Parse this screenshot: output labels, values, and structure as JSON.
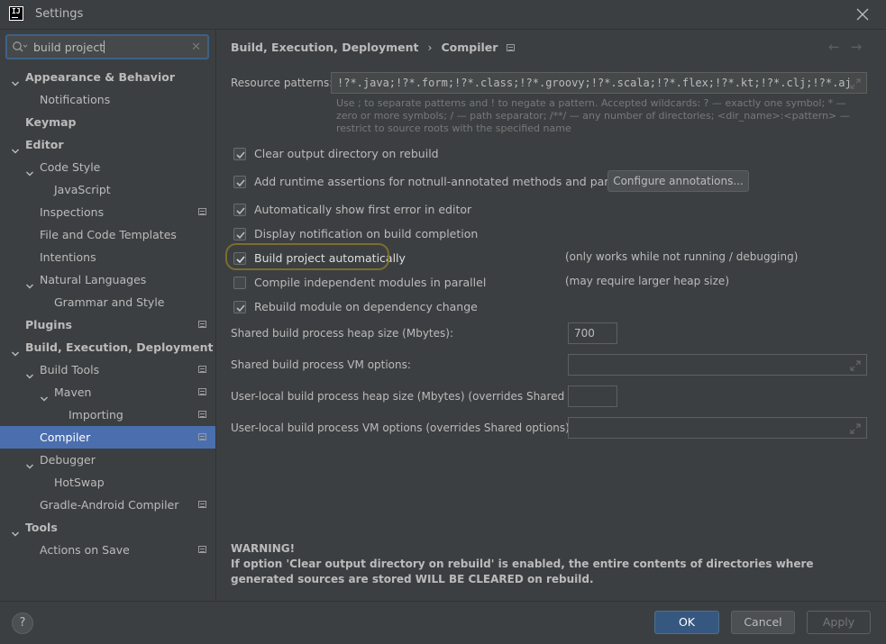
{
  "window": {
    "title": "Settings",
    "app_icon_text": "IJ"
  },
  "search": {
    "value": "build project"
  },
  "sidebar": {
    "items": [
      {
        "label": "Appearance & Behavior",
        "level": 0,
        "arrow": "down",
        "bold": true,
        "tag": false
      },
      {
        "label": "Notifications",
        "level": 1,
        "arrow": "",
        "bold": false,
        "tag": false
      },
      {
        "label": "Keymap",
        "level": 0,
        "arrow": "",
        "bold": true,
        "tag": false
      },
      {
        "label": "Editor",
        "level": 0,
        "arrow": "down",
        "bold": true,
        "tag": false
      },
      {
        "label": "Code Style",
        "level": 1,
        "arrow": "down",
        "bold": false,
        "tag": false
      },
      {
        "label": "JavaScript",
        "level": 2,
        "arrow": "",
        "bold": false,
        "tag": false
      },
      {
        "label": "Inspections",
        "level": 1,
        "arrow": "",
        "bold": false,
        "tag": true
      },
      {
        "label": "File and Code Templates",
        "level": 1,
        "arrow": "",
        "bold": false,
        "tag": false
      },
      {
        "label": "Intentions",
        "level": 1,
        "arrow": "",
        "bold": false,
        "tag": false
      },
      {
        "label": "Natural Languages",
        "level": 1,
        "arrow": "down",
        "bold": false,
        "tag": false
      },
      {
        "label": "Grammar and Style",
        "level": 2,
        "arrow": "",
        "bold": false,
        "tag": false
      },
      {
        "label": "Plugins",
        "level": 0,
        "arrow": "",
        "bold": true,
        "tag": true
      },
      {
        "label": "Build, Execution, Deployment",
        "level": 0,
        "arrow": "down",
        "bold": true,
        "tag": false
      },
      {
        "label": "Build Tools",
        "level": 1,
        "arrow": "down",
        "bold": false,
        "tag": true
      },
      {
        "label": "Maven",
        "level": 2,
        "arrow": "down",
        "bold": false,
        "tag": true
      },
      {
        "label": "Importing",
        "level": 3,
        "arrow": "",
        "bold": false,
        "tag": true
      },
      {
        "label": "Compiler",
        "level": 1,
        "arrow": "",
        "bold": false,
        "tag": true,
        "selected": true
      },
      {
        "label": "Debugger",
        "level": 1,
        "arrow": "down",
        "bold": false,
        "tag": false
      },
      {
        "label": "HotSwap",
        "level": 2,
        "arrow": "",
        "bold": false,
        "tag": false
      },
      {
        "label": "Gradle-Android Compiler",
        "level": 1,
        "arrow": "",
        "bold": false,
        "tag": true
      },
      {
        "label": "Tools",
        "level": 0,
        "arrow": "down",
        "bold": true,
        "tag": false
      },
      {
        "label": "Actions on Save",
        "level": 1,
        "arrow": "",
        "bold": false,
        "tag": true
      }
    ]
  },
  "breadcrumb": {
    "parent": "Build, Execution, Deployment",
    "separator": "›",
    "current": "Compiler"
  },
  "resource_patterns": {
    "label": "Resource patterns:",
    "value": "!?*.java;!?*.form;!?*.class;!?*.groovy;!?*.scala;!?*.flex;!?*.kt;!?*.clj;!?*.aj",
    "hint": "Use ; to separate patterns and ! to negate a pattern. Accepted wildcards: ? — exactly one symbol; * — zero or more symbols; / — path separator; /**/ — any number of directories; <dir_name>:<pattern> — restrict to source roots with the specified name"
  },
  "options": {
    "clear_output": {
      "label": "Clear output directory on rebuild",
      "checked": true
    },
    "runtime_assertions": {
      "label": "Add runtime assertions for notnull-annotated methods and parameters",
      "checked": true
    },
    "configure_annotations": "Configure annotations...",
    "show_first_error": {
      "label": "Automatically show first error in editor",
      "checked": true
    },
    "display_notification": {
      "label": "Display notification on build completion",
      "checked": true
    },
    "build_automatically": {
      "label": "Build project automatically",
      "checked": true,
      "note": "(only works while not running / debugging)"
    },
    "compile_parallel": {
      "label": "Compile independent modules in parallel",
      "checked": false,
      "note": "(may require larger heap size)"
    },
    "rebuild_module": {
      "label": "Rebuild module on dependency change",
      "checked": true
    }
  },
  "fields": {
    "shared_heap": {
      "label": "Shared build process heap size (Mbytes):",
      "value": "700"
    },
    "shared_vm": {
      "label": "Shared build process VM options:",
      "value": ""
    },
    "local_heap": {
      "label": "User-local build process heap size (Mbytes) (overrides Shared size):",
      "value": ""
    },
    "local_vm": {
      "label": "User-local build process VM options (overrides Shared options):",
      "value": ""
    }
  },
  "warning": {
    "title": "WARNING!",
    "text": "If option 'Clear output directory on rebuild' is enabled, the entire contents of directories where generated sources are stored WILL BE CLEARED on rebuild."
  },
  "buttons": {
    "help": "?",
    "ok": "OK",
    "cancel": "Cancel",
    "apply": "Apply"
  },
  "colors": {
    "background": "#3c3f41",
    "selection": "#4b6eaf",
    "focus": "#3d6185",
    "ok_button": "#365880"
  }
}
